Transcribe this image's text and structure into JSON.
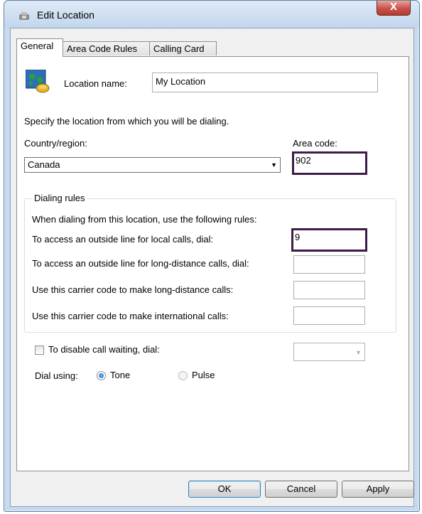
{
  "window": {
    "title": "Edit Location",
    "close_label": "X"
  },
  "tabs": [
    {
      "label": "General",
      "active": true
    },
    {
      "label": "Area Code Rules",
      "active": false
    },
    {
      "label": "Calling Card",
      "active": false
    }
  ],
  "general": {
    "location_name_label": "Location name:",
    "location_name_value": "My Location",
    "specify_text": "Specify the location from which you will be dialing.",
    "country_label": "Country/region:",
    "country_value": "Canada",
    "area_code_label": "Area code:",
    "area_code_value": "902",
    "dialing_rules": {
      "title": "Dialing rules",
      "intro": "When dialing from this location, use the following rules:",
      "local_label": "To access an outside line for local calls, dial:",
      "local_value": "9",
      "long_distance_label": "To access an outside line for long-distance calls, dial:",
      "long_distance_value": "",
      "carrier_long_label": "Use this carrier code to make long-distance calls:",
      "carrier_long_value": "",
      "carrier_intl_label": "Use this carrier code to make international calls:",
      "carrier_intl_value": ""
    },
    "call_waiting_label": "To disable call waiting, dial:",
    "call_waiting_checked": false,
    "call_waiting_value": "",
    "dial_using_label": "Dial using:",
    "tone_label": "Tone",
    "pulse_label": "Pulse",
    "selected_dial_mode": "Tone"
  },
  "buttons": {
    "ok": "OK",
    "cancel": "Cancel",
    "apply": "Apply"
  },
  "icons": {
    "title": "phone-title-icon",
    "location": "location-phone-icon",
    "dropdown": "chevron-down-icon"
  },
  "colors": {
    "highlight_border": "#3b1d47",
    "close_button": "#c75050",
    "window_frame": "#c6d9ee"
  }
}
